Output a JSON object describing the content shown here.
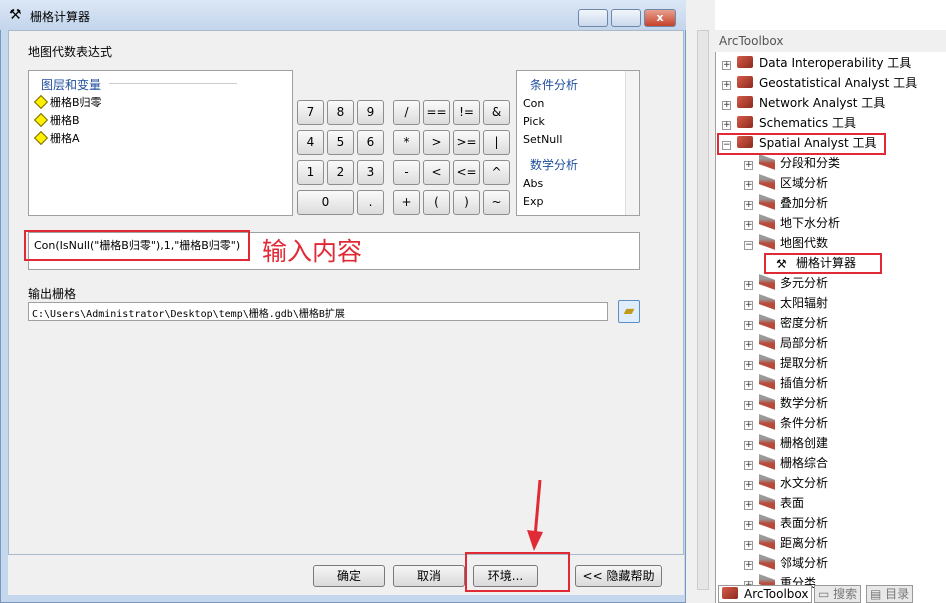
{
  "dialog": {
    "title": "栅格计算器",
    "section_label": "地图代数表达式",
    "layers": {
      "header": "图层和变量",
      "items": [
        "栅格B归零",
        "栅格B",
        "栅格A"
      ]
    },
    "keypad": [
      [
        "7",
        "8",
        "9",
        "/",
        "==",
        "!=",
        "&"
      ],
      [
        "4",
        "5",
        "6",
        "*",
        ">",
        ">=",
        "|"
      ],
      [
        "1",
        "2",
        "3",
        "-",
        "<",
        "<=",
        "^"
      ],
      [
        "0",
        ".",
        "+",
        "(",
        ")",
        "~"
      ]
    ],
    "functions": {
      "group1": "条件分析",
      "group1_items": [
        "Con",
        "Pick",
        "SetNull"
      ],
      "group2": "数学分析",
      "group2_items": [
        "Abs",
        "Exp"
      ]
    },
    "expression": "Con(IsNull(\"栅格B归零\"),1,\"栅格B归零\")",
    "annotation": "输入内容",
    "output_label": "输出栅格",
    "output_value": "C:\\Users\\Administrator\\Desktop\\temp\\栅格.gdb\\栅格B扩展",
    "buttons": {
      "ok": "确定",
      "cancel": "取消",
      "env": "环境...",
      "help": "<< 隐藏帮助"
    }
  },
  "toolbox": {
    "title": "ArcToolbox",
    "top_items": [
      "Data Interoperability 工具",
      "Geostatistical Analyst 工具",
      "Network Analyst 工具",
      "Schematics 工具",
      "Spatial Analyst 工具"
    ],
    "children_before": [
      "分段和分类",
      "区域分析",
      "叠加分析",
      "地下水分析",
      "地图代数"
    ],
    "tool": "栅格计算器",
    "children_after": [
      "多元分析",
      "太阳辐射",
      "密度分析",
      "局部分析",
      "提取分析",
      "插值分析",
      "数学分析",
      "条件分析",
      "栅格创建",
      "栅格综合",
      "水文分析",
      "表面",
      "表面分析",
      "距离分析",
      "邻域分析",
      "重分类"
    ],
    "tabs": [
      "ArcToolbox",
      "搜索",
      "目录"
    ]
  },
  "colors": {
    "highlight": "#e02a36",
    "header_text": "#1f4e9c"
  }
}
